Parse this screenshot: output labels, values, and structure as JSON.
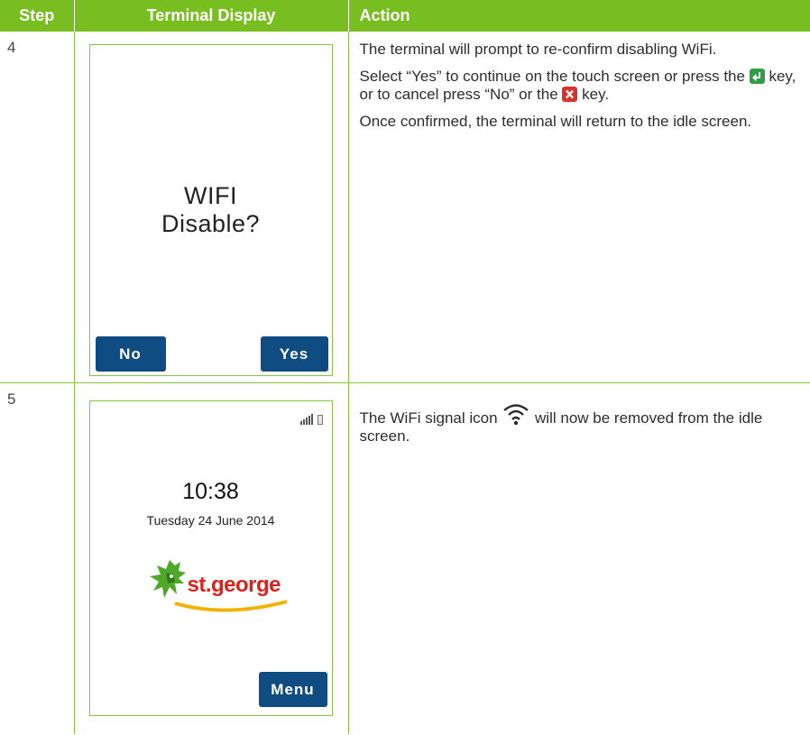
{
  "header": {
    "step": "Step",
    "display": "Terminal Display",
    "action": "Action"
  },
  "rows": [
    {
      "step": "4",
      "terminal": {
        "message_line1": "WIFI",
        "message_line2": "Disable?",
        "left_button": "No",
        "right_button": "Yes"
      },
      "action": {
        "p1": "The terminal will prompt to re-confirm disabling WiFi.",
        "p2_a": "Select “Yes” to continue on the touch screen or press the",
        "p2_b": "key, or to cancel press “No” or the",
        "p2_c": "key.",
        "p3": "Once confirmed, the terminal will return to the idle screen."
      }
    },
    {
      "step": "5",
      "terminal": {
        "time": "10:38",
        "date": "Tuesday 24 June 2014",
        "logo_text": "st.george",
        "menu_button": "Menu"
      },
      "action": {
        "p1_a": "The WiFi signal icon",
        "p1_b": "will now be removed from the idle screen."
      }
    }
  ],
  "colors": {
    "header_green": "#78be20",
    "button_blue": "#0f4c81",
    "logo_red": "#d9231d",
    "ok_key_green": "#2f9e44",
    "cancel_key_red": "#d9342b"
  },
  "icons": [
    "enter-key-icon",
    "cancel-key-icon",
    "wifi-icon",
    "signal-bars-icon",
    "battery-icon",
    "dragon-logo-icon"
  ]
}
